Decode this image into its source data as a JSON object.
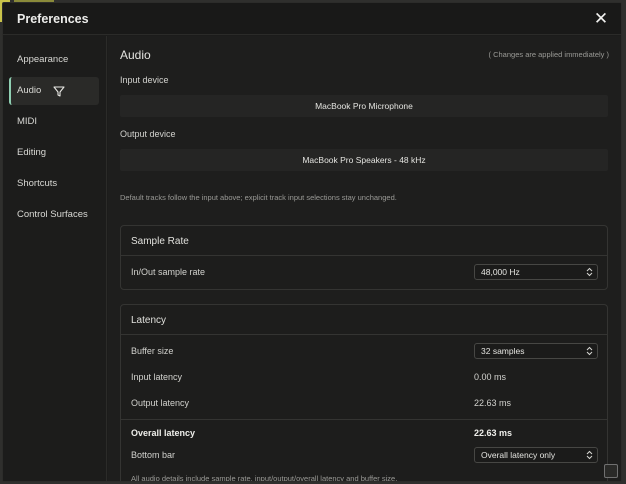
{
  "dialog": {
    "title": "Preferences"
  },
  "sidebar": {
    "items": [
      {
        "label": "Appearance"
      },
      {
        "label": "Audio",
        "active": true
      },
      {
        "label": "MIDI"
      },
      {
        "label": "Editing"
      },
      {
        "label": "Shortcuts"
      },
      {
        "label": "Control Surfaces"
      }
    ]
  },
  "audio": {
    "title": "Audio",
    "note": "( Changes are applied immediately )",
    "input_device_label": "Input device",
    "input_device_value": "MacBook Pro Microphone",
    "output_device_label": "Output device",
    "output_device_value": "MacBook Pro Speakers - 48 kHz",
    "hint": "Default tracks follow the input above; explicit track input selections stay unchanged.",
    "sample_rate": {
      "title": "Sample Rate",
      "row_label": "In/Out sample rate",
      "value": "48,000 Hz"
    },
    "latency": {
      "title": "Latency",
      "buffer_label": "Buffer size",
      "buffer_value": "32 samples",
      "input_label": "Input latency",
      "input_value": "0.00 ms",
      "output_label": "Output latency",
      "output_value": "22.63 ms",
      "overall_label": "Overall latency",
      "overall_value": "22.63 ms",
      "bottom_bar_label": "Bottom bar",
      "bottom_bar_value": "Overall latency only",
      "footnote": "All audio details include sample rate, input/output/overall latency and buffer size."
    }
  },
  "colors": {
    "accent": "#8fcfb2",
    "background": "#1e1e1d",
    "panel_border": "#343432"
  },
  "icons": {
    "close": "close-icon",
    "cursor": "funnel-cursor-icon",
    "chevron": "chevron-updown-icon",
    "grip": "resize-grip-icon"
  }
}
